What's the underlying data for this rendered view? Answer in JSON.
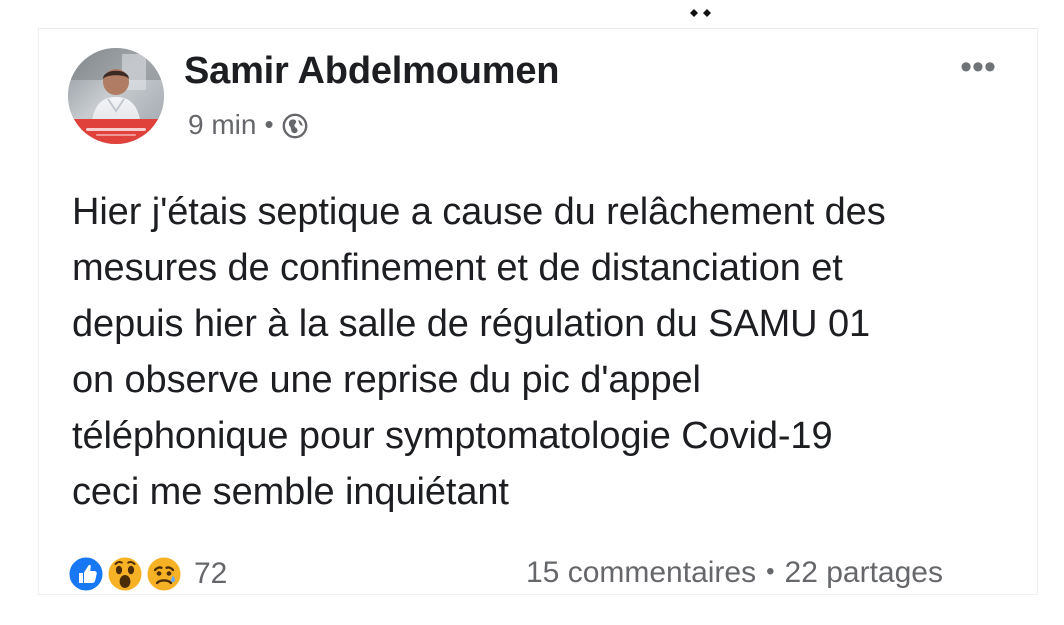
{
  "post": {
    "author_name": "Samir Abdelmoumen",
    "time_ago": "9 min",
    "meta_separator": "•",
    "visibility_icon": "globe-icon",
    "more_options_icon": "more-horizontal-icon",
    "more_options_text": "•••",
    "body_text": "Hier j'étais septique a cause du relâchement des\nmesures de confinement et de distanciation et\ndepuis hier à la salle de régulation du SAMU 01\non observe une reprise du pic d'appel\ntéléphonique pour symptomatologie Covid-19\nceci me semble inquiétant"
  },
  "reactions": {
    "icons": [
      {
        "name": "like-icon",
        "color": "#1877F2"
      },
      {
        "name": "wow-icon",
        "color": "#F7B125"
      },
      {
        "name": "sad-icon",
        "color": "#F7B125"
      }
    ],
    "count": "72"
  },
  "engagement": {
    "comments": "15 commentaires",
    "separator": "•",
    "shares": "22 partages"
  },
  "status_icon": "diamond-pair-icon",
  "colors": {
    "text_primary": "#1C1E21",
    "text_secondary": "#65676B",
    "like_blue": "#1877F2",
    "reaction_yellow": "#F7B125",
    "avatar_accent": "#E0423B"
  }
}
